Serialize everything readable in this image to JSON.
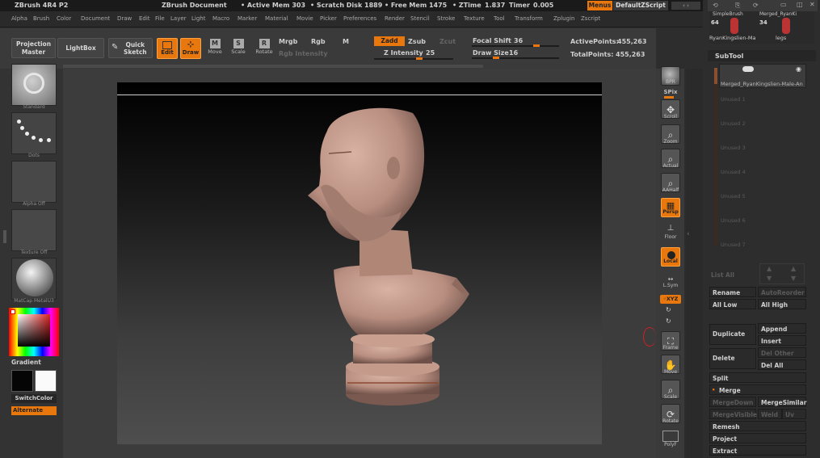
{
  "title": {
    "app": "ZBrush 4R4 P2",
    "document": "ZBrush Document",
    "active_mem": "• Active Mem 303",
    "scratch": "• Scratch Disk 1889",
    "free_mem": "• Free Mem 1475",
    "ztime": "• ZTime",
    "ztime_val": "1.837",
    "timer": "Timer",
    "timer_val": "0.005",
    "menus_btn": "Menus",
    "defaultzscript": "DefaultZScript"
  },
  "menus": [
    "Alpha",
    "Brush",
    "Color",
    "Document",
    "Draw",
    "Edit",
    "File",
    "Layer",
    "Light",
    "Macro",
    "Marker",
    "Material",
    "Movie",
    "Picker",
    "Preferences",
    "Render",
    "Stencil",
    "Stroke",
    "Texture",
    "Tool",
    "Transform",
    "Zplugin",
    "Zscript"
  ],
  "toolbar": {
    "projection_master_1": "Projection",
    "projection_master_2": "Master",
    "lightbox": "LightBox",
    "quick_sketch_1": "Quick",
    "quick_sketch_2": "Sketch",
    "edit": "Edit",
    "draw": "Draw",
    "move": "Move",
    "scale": "Scale",
    "rotate": "Rotate",
    "mrgb": "Mrgb",
    "rgb": "Rgb",
    "m": "M",
    "rgb_intensity": "Rgb Intensity",
    "zadd": "Zadd",
    "zsub": "Zsub",
    "zcut": "Zcut",
    "z_intensity": "Z Intensity",
    "z_intensity_val": "25",
    "focal_shift": "Focal Shift",
    "focal_shift_val": "36",
    "draw_size": "Draw Size",
    "draw_size_val": "16",
    "active_points": "ActivePoints:",
    "active_points_val": "455,263",
    "total_points": "TotalPoints:",
    "total_points_val": "455,263"
  },
  "left": {
    "brush": "Standard",
    "stroke": "Dots",
    "alpha": "Alpha Off",
    "texture": "Texture Off",
    "material": "MatCap MetalU3",
    "gradient": "Gradient",
    "switchcolor": "SwitchColor",
    "alternate": "Alternate"
  },
  "shelf": {
    "bpr": "BPR",
    "spix": "SPix",
    "scroll": "Scroll",
    "zoom": "Zoom",
    "actual": "Actual",
    "aahalf": "AAHalf",
    "persp": "Persp",
    "floor": "Floor",
    "local": "Local",
    "lsym": "L.Sym",
    "xyz": "◦XYZ",
    "frame": "Frame",
    "move": "Move",
    "scale": "Scale",
    "rotate": "Rotate",
    "polyf": "PolyF"
  },
  "subtool": {
    "thumb1_name": "SimpleBrush",
    "thumb2_name": "Merged_RyanKi",
    "num1": "64",
    "num2": "34",
    "thumb3_name": "RyanKingslien-Ma",
    "thumb4_name": "legs",
    "header": "SubTool",
    "active_item": "Merged_RyanKingslien-Male-An",
    "unused": [
      "Unused 1",
      "Unused 2",
      "Unused 3",
      "Unused 4",
      "Unused 5",
      "Unused 6",
      "Unused 7"
    ],
    "list_all": "List All",
    "rename": "Rename",
    "auto_reorder": "AutoReorder",
    "all_low": "All Low",
    "all_high": "All High",
    "duplicate": "Duplicate",
    "append": "Append",
    "insert": "Insert",
    "delete": "Delete",
    "del_other": "Del Other",
    "del_all": "Del All",
    "split": "Split",
    "merge": "Merge",
    "merge_down": "MergeDown",
    "merge_similar": "MergeSimilar",
    "merge_visible": "MergeVisible",
    "weld": "Weld",
    "uv": "Uv",
    "remesh": "Remesh",
    "project": "Project",
    "extract": "Extract"
  },
  "colors": {
    "accent": "#e8780e",
    "bust": "#c49a8a"
  }
}
